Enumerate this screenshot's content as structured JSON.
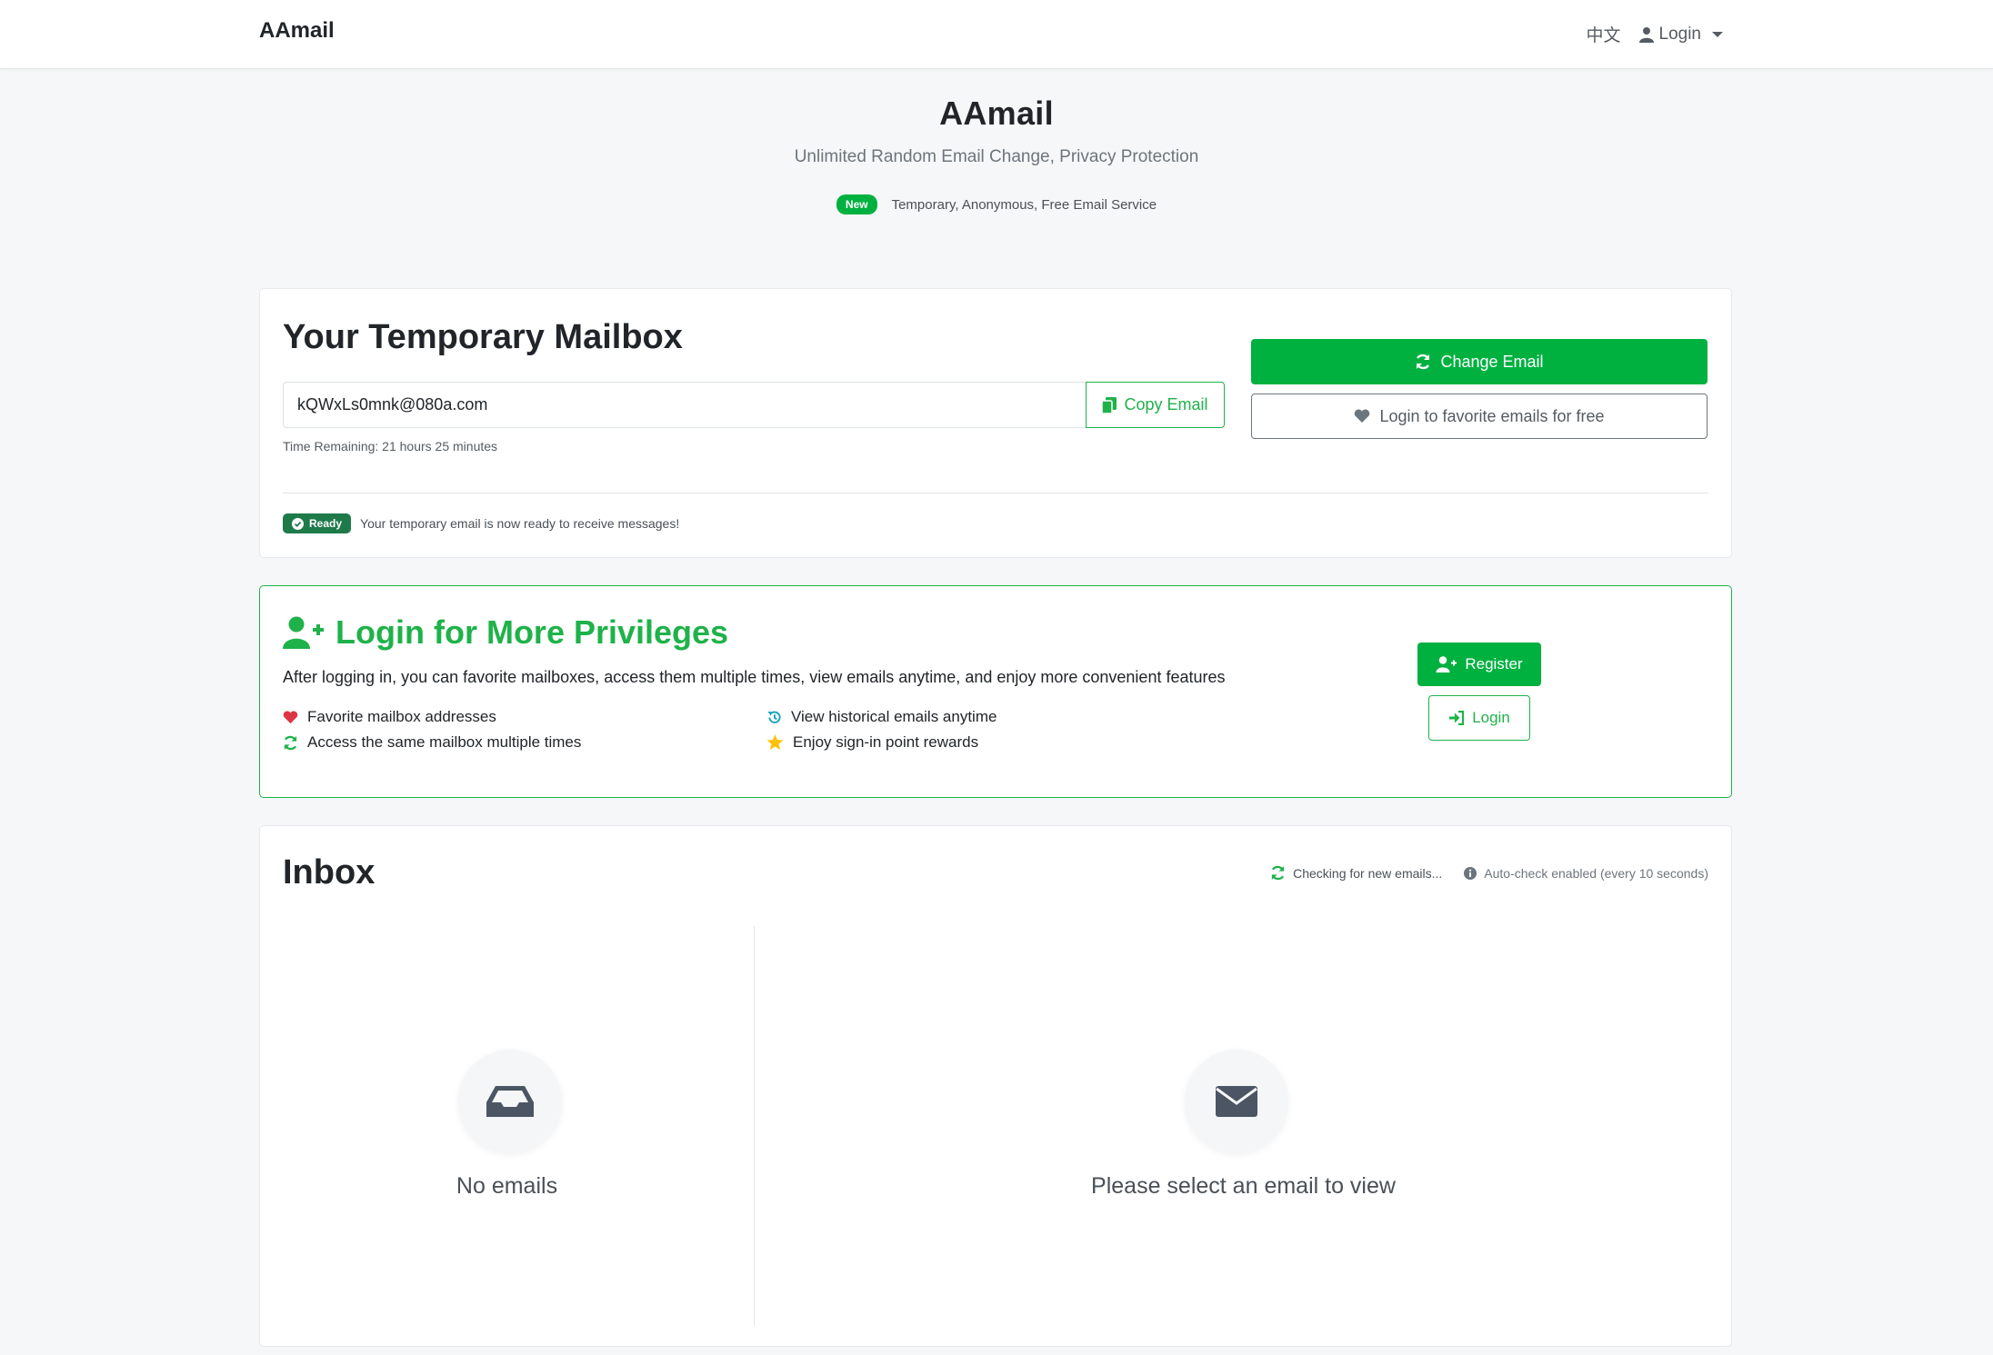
{
  "nav": {
    "brand": "AAmail",
    "lang": "中文",
    "login": "Login"
  },
  "hero": {
    "title": "AAmail",
    "subtitle": "Unlimited Random Email Change, Privacy Protection",
    "badge": "New",
    "tagline": "Temporary, Anonymous, Free Email Service"
  },
  "mailbox": {
    "title": "Your Temporary Mailbox",
    "email": "kQWxLs0mnk@080a.com",
    "copy_label": "Copy Email",
    "time_remaining": "Time Remaining: 21 hours 25 minutes",
    "change_label": "Change Email",
    "favorite_label": "Login to favorite emails for free",
    "ready_badge": "Ready",
    "ready_text": "Your temporary email is now ready to receive messages!"
  },
  "privileges": {
    "title": "Login for More Privileges",
    "description": "After logging in, you can favorite mailboxes, access them multiple times, view emails anytime, and enjoy more convenient features",
    "features": [
      {
        "label": "Favorite mailbox addresses",
        "icon": "heart-icon",
        "color": "#dc3545"
      },
      {
        "label": "View historical emails anytime",
        "icon": "history-icon",
        "color": "#17a2b8"
      },
      {
        "label": "Access the same mailbox multiple times",
        "icon": "sync-icon",
        "color": "#1fb24a"
      },
      {
        "label": "Enjoy sign-in point rewards",
        "icon": "star-icon",
        "color": "#ffc107"
      }
    ],
    "register_label": "Register",
    "login_label": "Login"
  },
  "inbox": {
    "title": "Inbox",
    "checking": "Checking for new emails...",
    "auto_check": "Auto-check enabled (every 10 seconds)",
    "empty_list": "No emails",
    "empty_view": "Please select an email to view"
  },
  "colors": {
    "primary": "#00b140",
    "accent_green": "#1fb24a",
    "ready_green": "#1f7a4a"
  }
}
